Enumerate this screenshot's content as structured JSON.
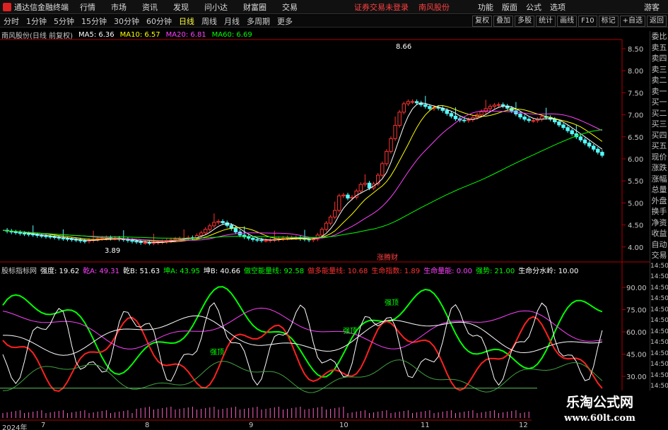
{
  "menubar": {
    "app_title": "通达信金融终端",
    "items": [
      "行情",
      "市场",
      "资讯",
      "发现",
      "问小达",
      "财富圈",
      "交易"
    ],
    "login_warning": "证券交易未登录",
    "stock_name": "南风股份",
    "right_items": [
      "功能",
      "版面",
      "公式",
      "选项"
    ],
    "guest": "游客"
  },
  "toolbar": {
    "periods": [
      "分时",
      "1分钟",
      "5分钟",
      "15分钟",
      "30分钟",
      "60分钟",
      "日线",
      "周线",
      "月线",
      "多周期",
      "更多"
    ],
    "active_period": "日线",
    "right_buttons": [
      "复权",
      "叠加",
      "多股",
      "统计",
      "画线",
      "F10",
      "标记",
      "+自选",
      "返回"
    ]
  },
  "main_legend": {
    "title": "南风股份(日线 前复权)",
    "ma5": "MA5: 6.36",
    "ma10": "MA10: 6.57",
    "ma20": "MA20: 6.81",
    "ma60": "MA60: 6.69"
  },
  "colors": {
    "up": "#ff3232",
    "down": "#54ffff",
    "ma5": "#ffffff",
    "ma10": "#ffff00",
    "ma20": "#ff40ff",
    "ma60": "#00ff00",
    "axis": "#b00000"
  },
  "price_axis": [
    "8.50",
    "8.00",
    "7.50",
    "7.00",
    "6.50",
    "6.00",
    "5.50",
    "5.00",
    "4.50",
    "4.00"
  ],
  "annotations": {
    "high": "8.66",
    "low": "3.89",
    "tag": "涨腾财"
  },
  "sub_legend": {
    "name": "股标指标网",
    "items": [
      {
        "text": "强度: 19.62",
        "color": "#ffffff"
      },
      {
        "text": "乾A: 49.31",
        "color": "#ff40ff"
      },
      {
        "text": "乾B: 51.63",
        "color": "#ffffff"
      },
      {
        "text": "坤A: 43.95",
        "color": "#00ff00"
      },
      {
        "text": "坤B: 40.66",
        "color": "#ffffff"
      },
      {
        "text": "做空能量线: 92.58",
        "color": "#00ff00"
      },
      {
        "text": "做多能量线: 10.68",
        "color": "#ff3232"
      },
      {
        "text": "生命指数: 1.89",
        "color": "#ff3232"
      },
      {
        "text": "生命量能: 0.00",
        "color": "#ff40ff"
      },
      {
        "text": "强势: 21.00",
        "color": "#00ff00"
      },
      {
        "text": "生命分水岭: 10.00",
        "color": "#ffffff"
      }
    ],
    "labels": [
      "强顶",
      "强顶",
      "强顶"
    ]
  },
  "sub_axis": [
    "90.00",
    "75.00",
    "60.00",
    "45.00",
    "30.00"
  ],
  "right_panel": [
    "委比",
    "卖五",
    "卖四",
    "卖三",
    "卖二",
    "卖一",
    "买一",
    "买二",
    "买三",
    "买四",
    "买五",
    "现价",
    "涨跌",
    "涨幅",
    "总量",
    "外盘",
    "换手",
    "净资",
    "收益",
    "自动",
    "交易",
    "14:50",
    "14:50",
    "14:50",
    "14:50",
    "14:50",
    "14:50",
    "14:50",
    "14:50",
    "14:50",
    "14:50",
    "14:50",
    "14:50"
  ],
  "date_axis": {
    "year_label": "2024年",
    "months": [
      "7",
      "8",
      "9",
      "10",
      "11",
      "12"
    ]
  },
  "watermark": {
    "title": "乐淘公式网",
    "url": "www.60lt.com"
  }
}
